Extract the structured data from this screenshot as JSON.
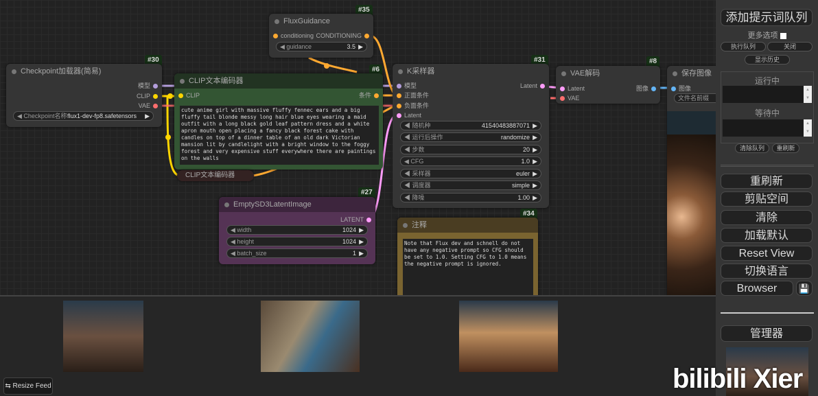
{
  "nodes": {
    "flux_guidance": {
      "id": "#35",
      "title": "FluxGuidance",
      "input": "conditioning",
      "output": "CONDITIONING",
      "widget_label": "guidance",
      "widget_value": "3.5"
    },
    "checkpoint": {
      "id": "#30",
      "title": "Checkpoint加载器(简易)",
      "outputs": [
        "模型",
        "CLIP",
        "VAE"
      ],
      "widget_label": "Checkpoint名称",
      "widget_value": "flux1-dev-fp8.safetensors"
    },
    "clip_encoder": {
      "id": "#6",
      "title": "CLIP文本编码器",
      "input": "CLIP",
      "output": "条件",
      "text": "cute anime girl with massive fluffy fennec ears and a big fluffy tail blonde messy long hair blue eyes wearing a maid outfit with a long black gold leaf pattern dress and a white apron mouth open placing a fancy black forest cake with candles on top of a dinner table of an old dark Victorian mansion lit by candlelight with a bright window to the foggy forest and very expensive stuff everywhere there are paintings on the walls"
    },
    "clip_collapsed": {
      "title": "CLIP文本编码器"
    },
    "ksampler": {
      "id": "#31",
      "title": "K采样器",
      "inputs": [
        "模型",
        "正面条件",
        "负面条件",
        "Latent"
      ],
      "output": "Latent",
      "widgets": [
        {
          "label": "随机种",
          "value": "41540483887071"
        },
        {
          "label": "运行后操作",
          "value": "randomize"
        },
        {
          "label": "步数",
          "value": "20"
        },
        {
          "label": "CFG",
          "value": "1.0"
        },
        {
          "label": "采样器",
          "value": "euler"
        },
        {
          "label": "调度器",
          "value": "simple"
        },
        {
          "label": "降噪",
          "value": "1.00"
        }
      ]
    },
    "vae_decode": {
      "id": "#8",
      "title": "VAE解码",
      "inputs": [
        "Latent",
        "VAE"
      ],
      "output": "图像"
    },
    "save_image": {
      "title": "保存图像",
      "input": "图像",
      "widget_label": "文件名前缀"
    },
    "empty_latent": {
      "id": "#27",
      "title": "EmptySD3LatentImage",
      "output": "LATENT",
      "widgets": [
        {
          "label": "width",
          "value": "1024"
        },
        {
          "label": "height",
          "value": "1024"
        },
        {
          "label": "batch_size",
          "value": "1"
        }
      ]
    },
    "note": {
      "id": "#34",
      "title": "注释",
      "text": "Note that Flux dev and schnell do not have any negative prompt so CFG should be set to 1.0. Setting CFG to 1.0 means the negative prompt is ignored."
    }
  },
  "feed": {
    "resize_label": "Resize Feed"
  },
  "panel": {
    "queue_prompt": "添加提示词队列",
    "more_options": "更多选项",
    "exec_queue": "执行队列",
    "close": "关闭",
    "show_history": "显示历史",
    "running": "运行中",
    "pending": "等待中",
    "clear_queue": "清除队列",
    "refresh_small": "重刷新",
    "buttons": [
      "重刷新",
      "剪贴空间",
      "清除",
      "加载默认",
      "Reset View",
      "切换语言"
    ],
    "browser": "Browser",
    "manager": "管理器"
  },
  "watermark": "bilibili Xier",
  "colors": {
    "model": "#b39ddb",
    "clip": "#ffd500",
    "vae": "#ff6e6e",
    "conditioning": "#ffa931",
    "latent": "#ff9cf9",
    "image": "#64b5f6"
  }
}
